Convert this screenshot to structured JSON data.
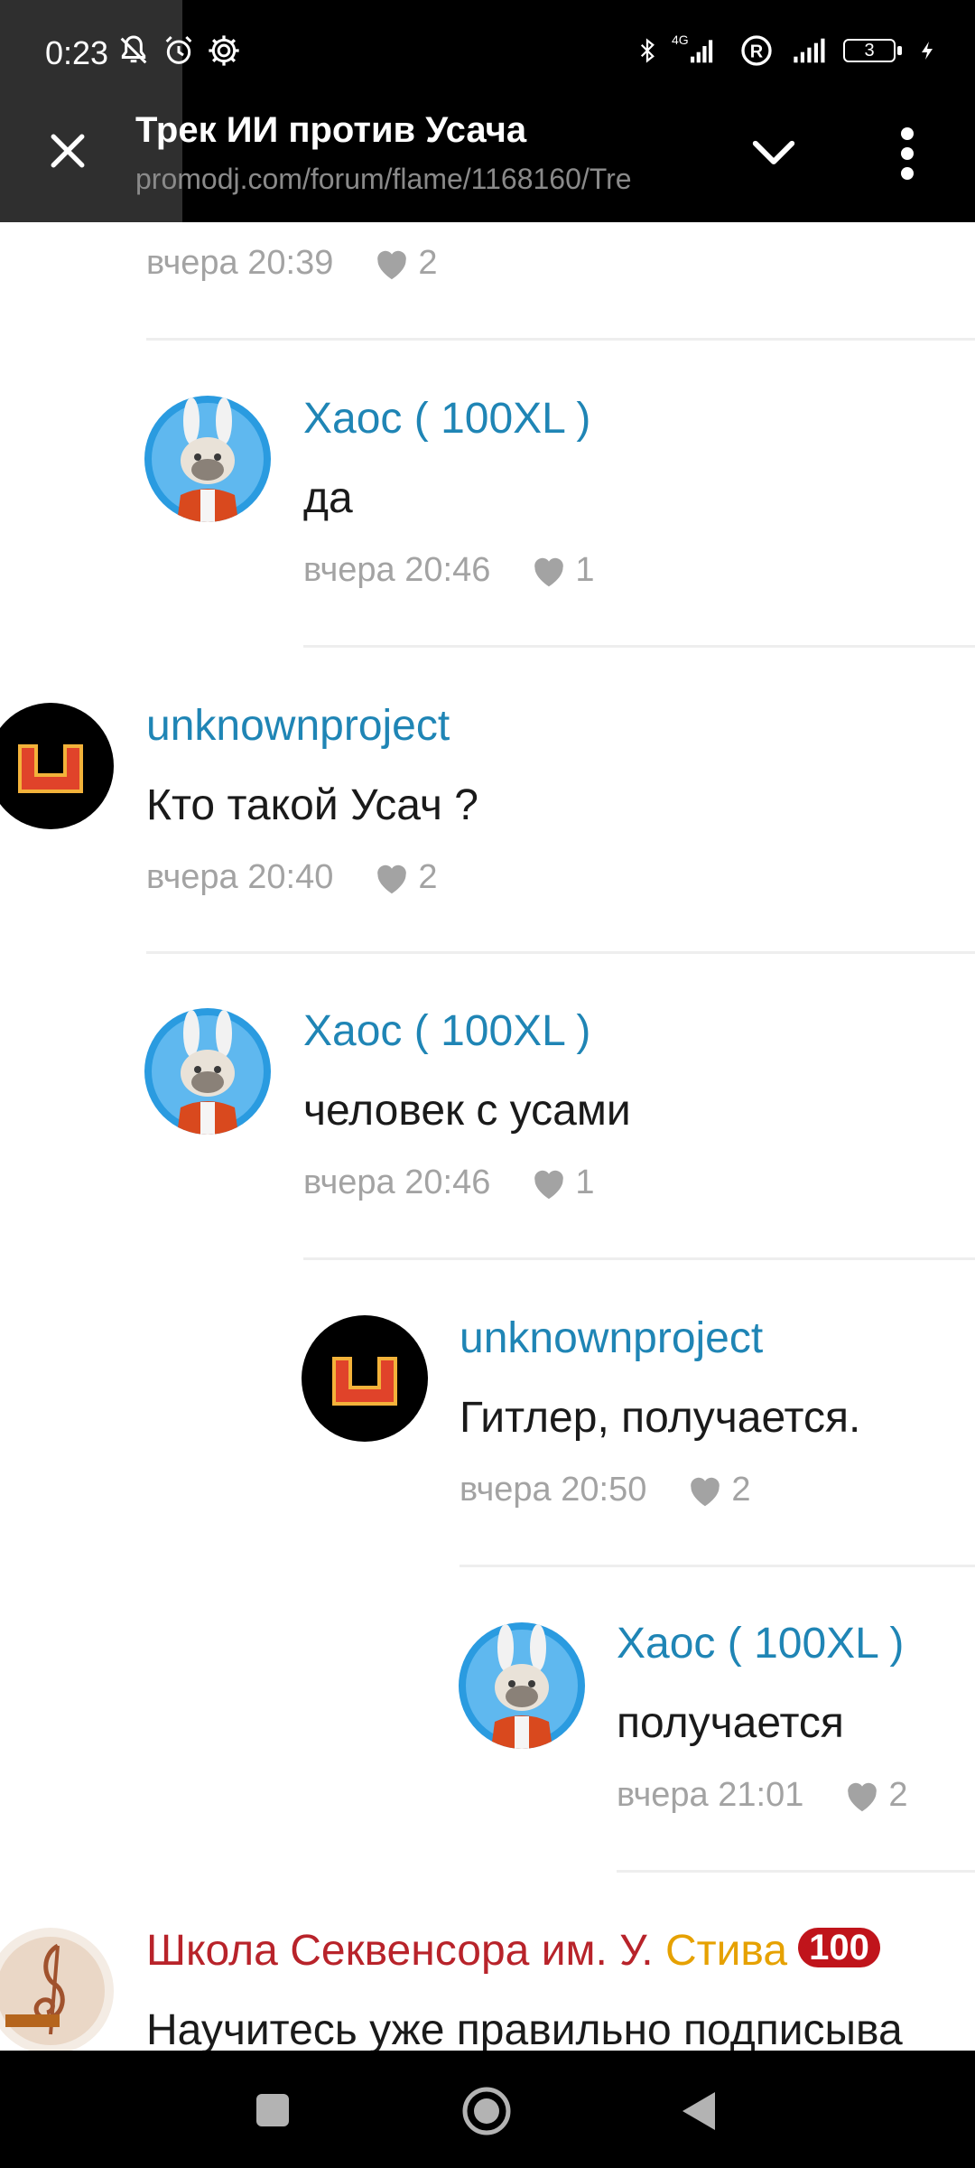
{
  "status_bar": {
    "time": "0:23",
    "network_label": "4G",
    "battery_level": "3"
  },
  "tab": {
    "title": "Трек ИИ против Усача",
    "url": "promodj.com/forum/flame/1168160/Tre"
  },
  "comments": [
    {
      "id": "c0",
      "author": "",
      "text": "",
      "time": "вчера 20:39",
      "likes": "2"
    },
    {
      "id": "c1",
      "author": "Хаос ( 100XL )",
      "text": "да",
      "time": "вчера 20:46",
      "likes": "1"
    },
    {
      "id": "c2",
      "author": "unknownproject",
      "text": "Кто такой Усач ?",
      "time": "вчера 20:40",
      "likes": "2"
    },
    {
      "id": "c3",
      "author": "Хаос ( 100XL )",
      "text": "человек с усами",
      "time": "вчера 20:46",
      "likes": "1"
    },
    {
      "id": "c4",
      "author": "unknownproject",
      "text": "Гитлер, получается.",
      "time": "вчера 20:50",
      "likes": "2"
    },
    {
      "id": "c5",
      "author": "Хаос ( 100XL )",
      "text": "получается",
      "time": "вчера 21:01",
      "likes": "2"
    }
  ],
  "last_comment": {
    "author_part1": "Школа Секвенсора им. У. ",
    "author_part2": "Стива",
    "badge": "100",
    "text": "Научитесь уже правильно подписыва"
  },
  "colors": {
    "author_link": "#1f85b5",
    "meta_gray": "#a3a3a3",
    "school_red": "#b8232a",
    "school_gold": "#e6a100",
    "badge_red": "#c0141b"
  },
  "icons": [
    "mute-bell-icon",
    "alarm-icon",
    "settings-gear-icon",
    "bluetooth-icon",
    "signal-icon",
    "roaming-r-icon",
    "battery-icon",
    "charging-icon",
    "close-icon",
    "chevron-down-icon",
    "more-vert-icon",
    "heart-icon",
    "recent-apps-icon",
    "home-icon",
    "back-icon"
  ]
}
